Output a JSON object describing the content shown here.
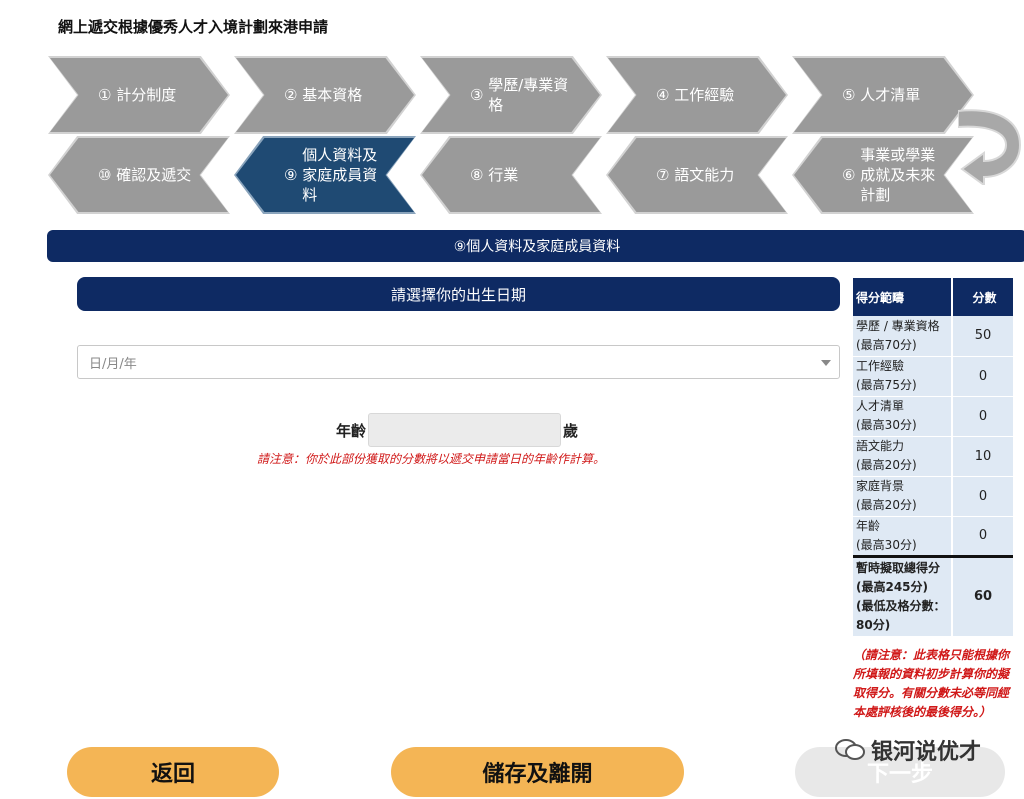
{
  "page": {
    "title": "網上遞交根據優秀人才入境計劃來港申請"
  },
  "steps": {
    "row1": [
      {
        "num": "①",
        "label": "計分制度"
      },
      {
        "num": "②",
        "label": "基本資格"
      },
      {
        "num": "③",
        "label": "學歷/專業資格"
      },
      {
        "num": "④",
        "label": "工作經驗"
      },
      {
        "num": "⑤",
        "label": "人才清單"
      }
    ],
    "row2": [
      {
        "num": "⑩",
        "label": "確認及遞交"
      },
      {
        "num": "⑨",
        "label": "個人資料及家庭成員資料"
      },
      {
        "num": "⑧",
        "label": "行業"
      },
      {
        "num": "⑦",
        "label": "語文能力"
      },
      {
        "num": "⑥",
        "label": "事業或學業成就及未來計劃"
      }
    ]
  },
  "section": {
    "title": "⑨個人資料及家庭成員資料"
  },
  "form": {
    "dob_heading": "請選擇你的出生日期",
    "dob_placeholder": "日/月/年",
    "age_label": "年齡",
    "age_unit": "歲",
    "notice": "請注意：你於此部份獲取的分數將以遞交申請當日的年齡作計算。"
  },
  "score_table": {
    "header_category": "得分範疇",
    "header_score": "分數",
    "rows": [
      {
        "name": "學歷 / 專業資格",
        "max": "(最高70分)",
        "score": "50"
      },
      {
        "name": "工作經驗",
        "max": "(最高75分)",
        "score": "0"
      },
      {
        "name": "人才清單",
        "max": "(最高30分)",
        "score": "0"
      },
      {
        "name": "語文能力",
        "max": "(最高20分)",
        "score": "10"
      },
      {
        "name": "家庭背景",
        "max": "(最高20分)",
        "score": "0"
      },
      {
        "name": "年齡",
        "max": "(最高30分)",
        "score": "0"
      }
    ],
    "total": {
      "name": "暫時擬取總得分",
      "max": "(最高245分)",
      "pass": "(最低及格分數：80分)",
      "score": "60"
    },
    "note": "（請注意：此表格只能根據你所填報的資料初步計算你的擬取得分。有關分數未必等同經本處評核後的最後得分。）"
  },
  "buttons": {
    "back": "返回",
    "save": "儲存及離開",
    "next": "下一步"
  },
  "watermark": {
    "text": "银河说优才"
  },
  "colors": {
    "navy": "#0e2a63",
    "active_step": "#1f4a73",
    "step_gray": "#9a9a9a",
    "button": "#f4b555",
    "alert": "#d01818"
  }
}
